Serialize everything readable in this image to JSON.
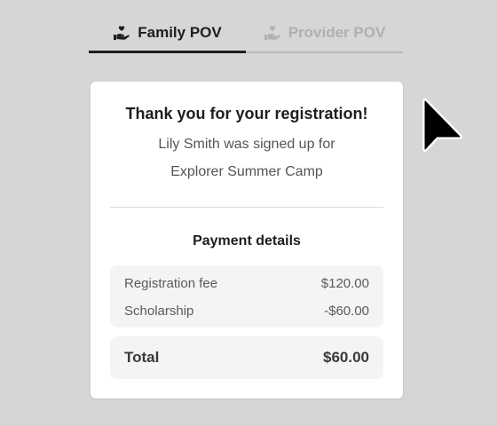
{
  "tabs": [
    {
      "label": "Family POV",
      "icon": "hand-heart-icon",
      "active": true
    },
    {
      "label": "Provider POV",
      "icon": "hand-heart-icon",
      "active": false
    }
  ],
  "card": {
    "title": "Thank you for your registration!",
    "line1": "Lily Smith was signed up for",
    "line2": "Explorer Summer Camp",
    "payment_title": "Payment details",
    "fees": [
      {
        "label": "Registration fee",
        "amount": "$120.00"
      },
      {
        "label": "Scholarship",
        "amount": "-$60.00"
      }
    ],
    "total": {
      "label": "Total",
      "amount": "$60.00"
    }
  },
  "colors": {
    "background": "#d6d6d6",
    "active_tab": "#1e1e1e",
    "inactive_tab": "#b0b0b0",
    "card": "#ffffff",
    "row_background": "#f4f4f4"
  }
}
